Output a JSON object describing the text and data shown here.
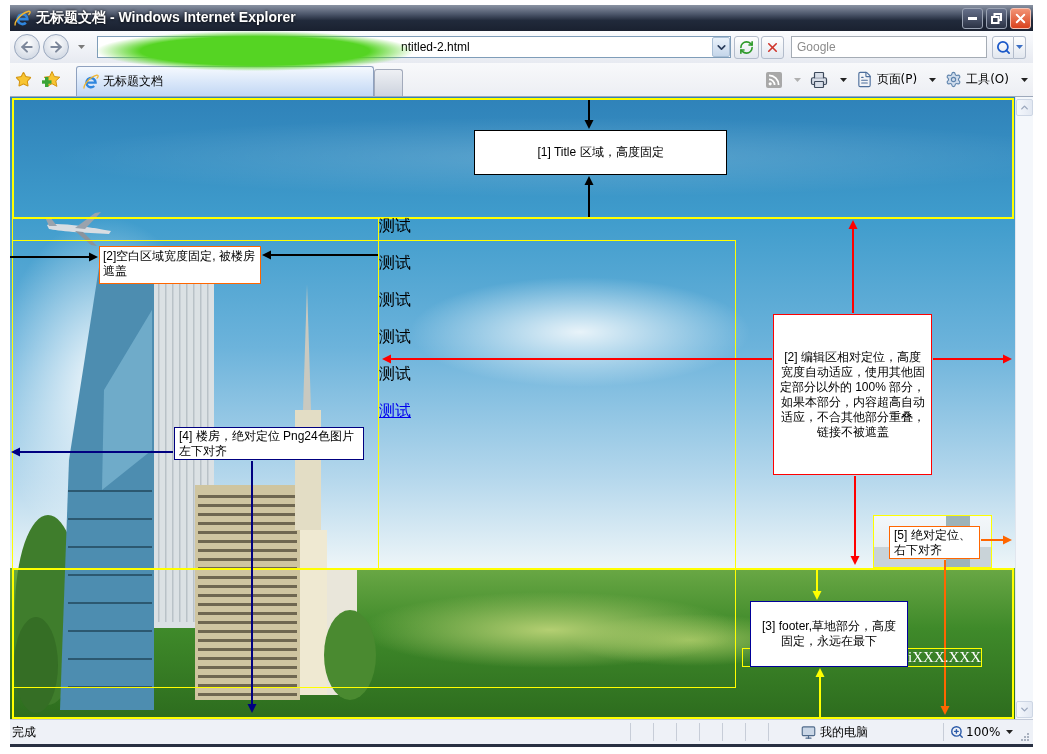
{
  "window": {
    "title": "无标题文档 - Windows Internet Explorer"
  },
  "navigation": {
    "address": "ntitled-2.html",
    "search_placeholder": "Google"
  },
  "tabs": [
    {
      "label": "无标题文档",
      "selected": true
    }
  ],
  "command_bar": [
    {
      "kind": "feeds",
      "disabled": true
    },
    {
      "kind": "print",
      "disabled": false
    },
    {
      "kind": "page",
      "label": "页面(P)",
      "disabled": false
    },
    {
      "kind": "tools",
      "label": "工具(O)",
      "disabled": false
    }
  ],
  "page": {
    "test_items": [
      {
        "kind": "text",
        "text": "测试"
      },
      {
        "kind": "text",
        "text": "测试"
      },
      {
        "kind": "text",
        "text": "测试"
      },
      {
        "kind": "text",
        "text": "测试"
      },
      {
        "kind": "text",
        "text": "测试"
      },
      {
        "kind": "link",
        "text": "测试"
      }
    ],
    "annotations": [
      {
        "text": "[1] Title 区域，高度固定",
        "color": "#000000",
        "arrows": [
          {
            "color": "#000000"
          },
          {
            "color": "#000000"
          }
        ]
      },
      {
        "text": "[2]空白区域宽度固定, 被楼房遮盖",
        "color": "#ff6600",
        "arrows": [
          {
            "color": "#000000"
          },
          {
            "color": "#000000"
          }
        ]
      },
      {
        "text": "[2] 编辑区相对定位，高度宽度自动适应，使用其他固定部分以外的 100% 部分，如果本部分，内容超高自动适应，不合其他部分重叠，链接不被遮盖",
        "color": "#ff0000",
        "arrows": [
          {
            "color": "#ff0000"
          },
          {
            "color": "#ff0000"
          },
          {
            "color": "#ff0000"
          },
          {
            "color": "#ff0000"
          }
        ]
      },
      {
        "text": "[4] 楼房，绝对定位 Png24色图片左下对齐",
        "color": "#000080",
        "arrows": [
          {
            "color": "#000080"
          },
          {
            "color": "#000080"
          }
        ]
      },
      {
        "text": "[5] 绝对定位、右下对齐",
        "color": "#ff6600",
        "arrows": [
          {
            "color": "#ff6600"
          },
          {
            "color": "#ff6600"
          }
        ]
      },
      {
        "text": "[3] footer,草地部分，高度固定，永远在最下",
        "color": "#000099",
        "arrows": [
          {
            "color": "#ffff00"
          },
          {
            "color": "#ffff00"
          }
        ]
      }
    ],
    "footer_texts": [
      "iXXX.XXX"
    ]
  },
  "status_bar": {
    "text": "完成",
    "zone": "我的电脑",
    "zoom": "100%"
  }
}
